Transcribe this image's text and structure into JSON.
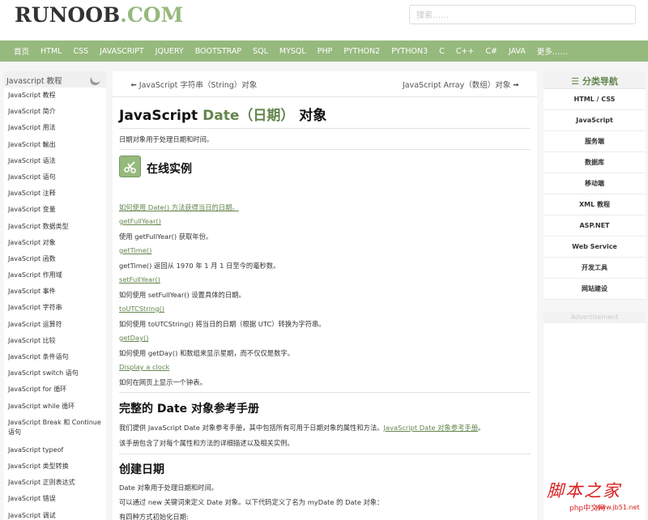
{
  "header": {
    "logo_main": "RUNOOB",
    "logo_suffix": ".COM",
    "search_placeholder": "搜索……"
  },
  "nav": [
    "首页",
    "HTML",
    "CSS",
    "JAVASCRIPT",
    "JQUERY",
    "BOOTSTRAP",
    "SQL",
    "MYSQL",
    "PHP",
    "PYTHON2",
    "PYTHON3",
    "C",
    "C++",
    "C#",
    "JAVA",
    "更多……"
  ],
  "sidebar": {
    "title": "Javascript 教程",
    "items": [
      "JavaScript 教程",
      "JavaScript 简介",
      "JavaScript 用法",
      "JavaScript 輸出",
      "JavaScript 语法",
      "JavaScript 语句",
      "JavaScript 注释",
      "JavaScript 变量",
      "JavaScript 数据类型",
      "JavaScript 对象",
      "JavaScript 函数",
      "JavaScript 作用域",
      "JavaScript 事件",
      "JavaScript 字符串",
      "JavaScript 运算符",
      "JavaScript 比较",
      "JavaScript 条件语句",
      "JavaScript switch 语句",
      "JavaScript for 循环",
      "JavaScript while 循环",
      "JavaScript Break 和 Continue 语句",
      "JavaScript typeof",
      "JavaScript 类型转换",
      "JavaScript 正则表达式",
      "JavaScript 错误",
      "JavaScript 调试"
    ]
  },
  "main": {
    "prev": "JavaScript 字符串（String）对象",
    "next": "JavaScript Array（数组）对象",
    "title_a": "JavaScript ",
    "title_b": "Date（日期）",
    "title_c": " 对象",
    "intro": "日期对象用于处理日期和时间。",
    "examples_heading": "在线实例",
    "examples": [
      {
        "link": "如何使用 Date() 方法获得当日的日期。",
        "desc": ""
      },
      {
        "link": "getFullYear()",
        "desc": "使用 getFullYear() 获取年份。"
      },
      {
        "link": "getTime()",
        "desc": "getTime() 返回从 1970 年 1 月 1 日至今的毫秒数。"
      },
      {
        "link": "setFullYear()",
        "desc": "如何使用 setFullYear() 设置具体的日期。"
      },
      {
        "link": "toUTCString()",
        "desc": "如何使用 toUTCString() 将当日的日期（根据 UTC）转换为字符串。"
      },
      {
        "link": "getDay()",
        "desc": "如何使用 getDay() 和数组来显示星期，而不仅仅是数字。"
      },
      {
        "link": "Display a clock",
        "desc": "如何在网页上显示一个钟表。"
      }
    ],
    "ref_heading": "完整的 Date 对象参考手册",
    "ref_text": "我们提供 JavaScript Date 对象参考手册，其中包括所有可用于日期对象的属性和方法。",
    "ref_link": "JavaScript Date 对象参考手册",
    "ref_text2": "。",
    "ref_text3": "该手册包含了对每个属性和方法的详细描述以及相关实例。",
    "create_heading": "创建日期",
    "create_p1": "Date 对象用于处理日期和时间。",
    "create_p2": "可以通过 new 关键词来定义 Date 对象。以下代码定义了名为 myDate 的 Date 对象：",
    "create_p3": "有四种方式初始化日期:"
  },
  "right": {
    "title": "分类导航",
    "items": [
      "HTML / CSS",
      "JavaScript",
      "服务端",
      "数据库",
      "移动端",
      "XML 教程",
      "ASP.NET",
      "Web Service",
      "开发工具",
      "网站建设"
    ],
    "ad_label": "Advertisement"
  },
  "watermark": {
    "big": "脚本之家",
    "small": "php中文网",
    "url": "www.jb51.net"
  },
  "colors": {
    "accent": "#96b97d",
    "link": "#64854c",
    "nav_bg": "#96b97d"
  }
}
